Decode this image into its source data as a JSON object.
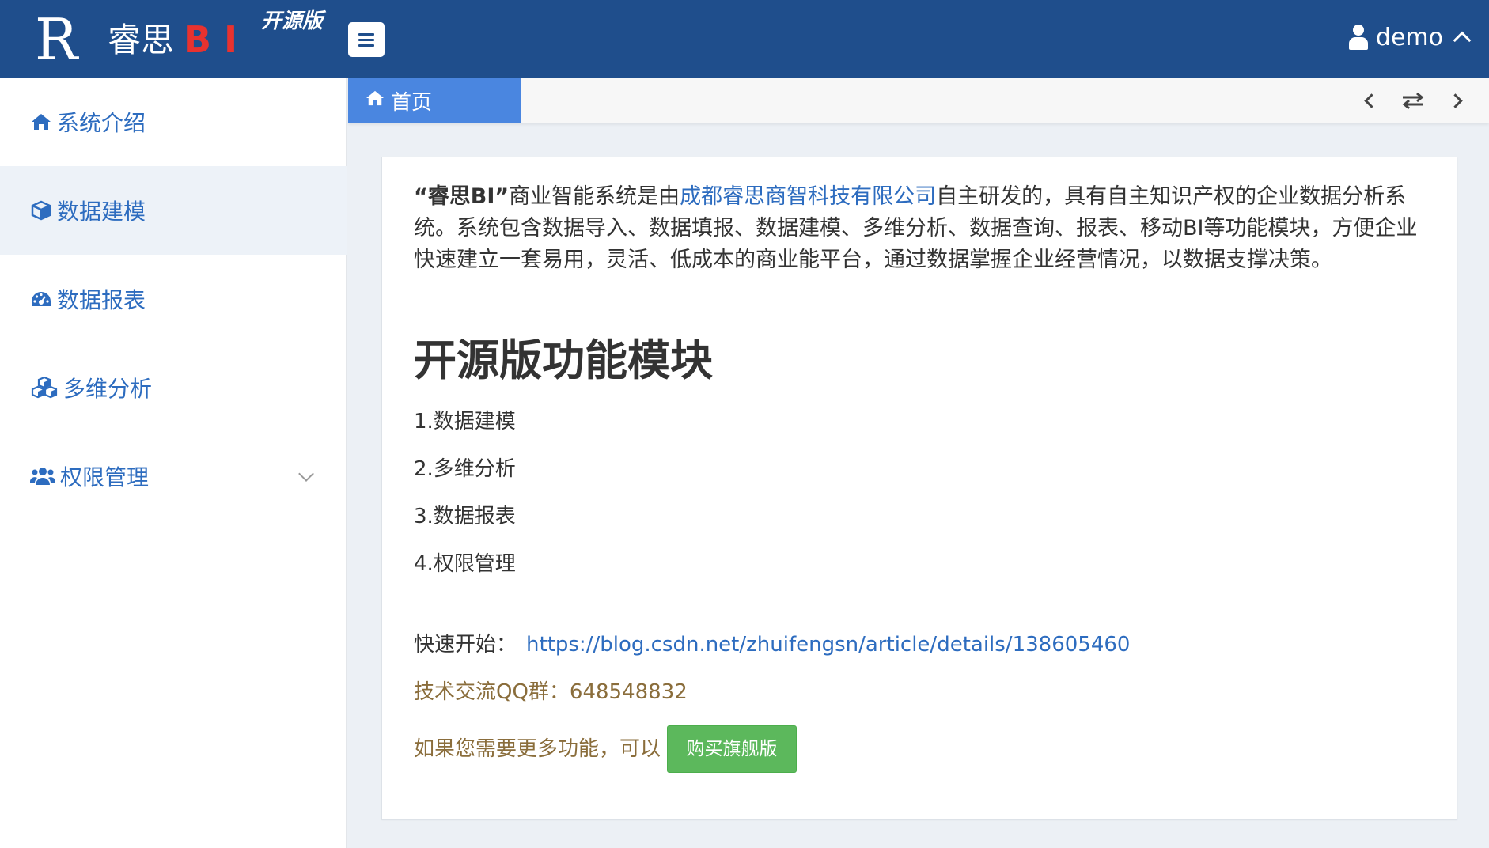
{
  "header": {
    "logo_name": "睿思",
    "logo_bi": "BI",
    "edition": "开源版",
    "user": "demo"
  },
  "sidebar": {
    "items": [
      {
        "label": "系统介绍",
        "icon": "home-icon"
      },
      {
        "label": "数据建模",
        "icon": "cube-icon"
      },
      {
        "label": "数据报表",
        "icon": "dashboard-icon"
      },
      {
        "label": "多维分析",
        "icon": "cubes-icon"
      },
      {
        "label": "权限管理",
        "icon": "users-icon"
      }
    ]
  },
  "tabs": [
    {
      "label": "首页",
      "icon": "home-icon"
    }
  ],
  "content": {
    "intro_brand": "“睿思BI”",
    "intro_pre": "商业智能系统是由",
    "intro_company": "成都睿思商智科技有限公司",
    "intro_post": "自主研发的，具有自主知识产权的企业数据分析系统。系统包含数据导入、数据填报、数据建模、多维分析、数据查询、报表、移动BI等功能模块，方便企业快速建立一套易用，灵活、低成本的商业能平台，通过数据掌握企业经营情况，以数据支撑决策。",
    "section_title": "开源版功能模块",
    "features": [
      "1.数据建模",
      "2.多维分析",
      "3.数据报表",
      "4.权限管理"
    ],
    "quickstart_label": "快速开始：",
    "quickstart_link": "https://blog.csdn.net/zhuifengsn/article/details/138605460",
    "qq_group": "技术交流QQ群：648548832",
    "more_text": "如果您需要更多功能，可以",
    "buy_button": "购买旗舰版"
  },
  "colors": {
    "header_bg": "#1f4e8c",
    "tab_active": "#4a86e0",
    "link": "#2d6cbf",
    "warning_text": "#8a6d3b",
    "success_button": "#5cb85c",
    "logo_bi": "#e8322f"
  }
}
